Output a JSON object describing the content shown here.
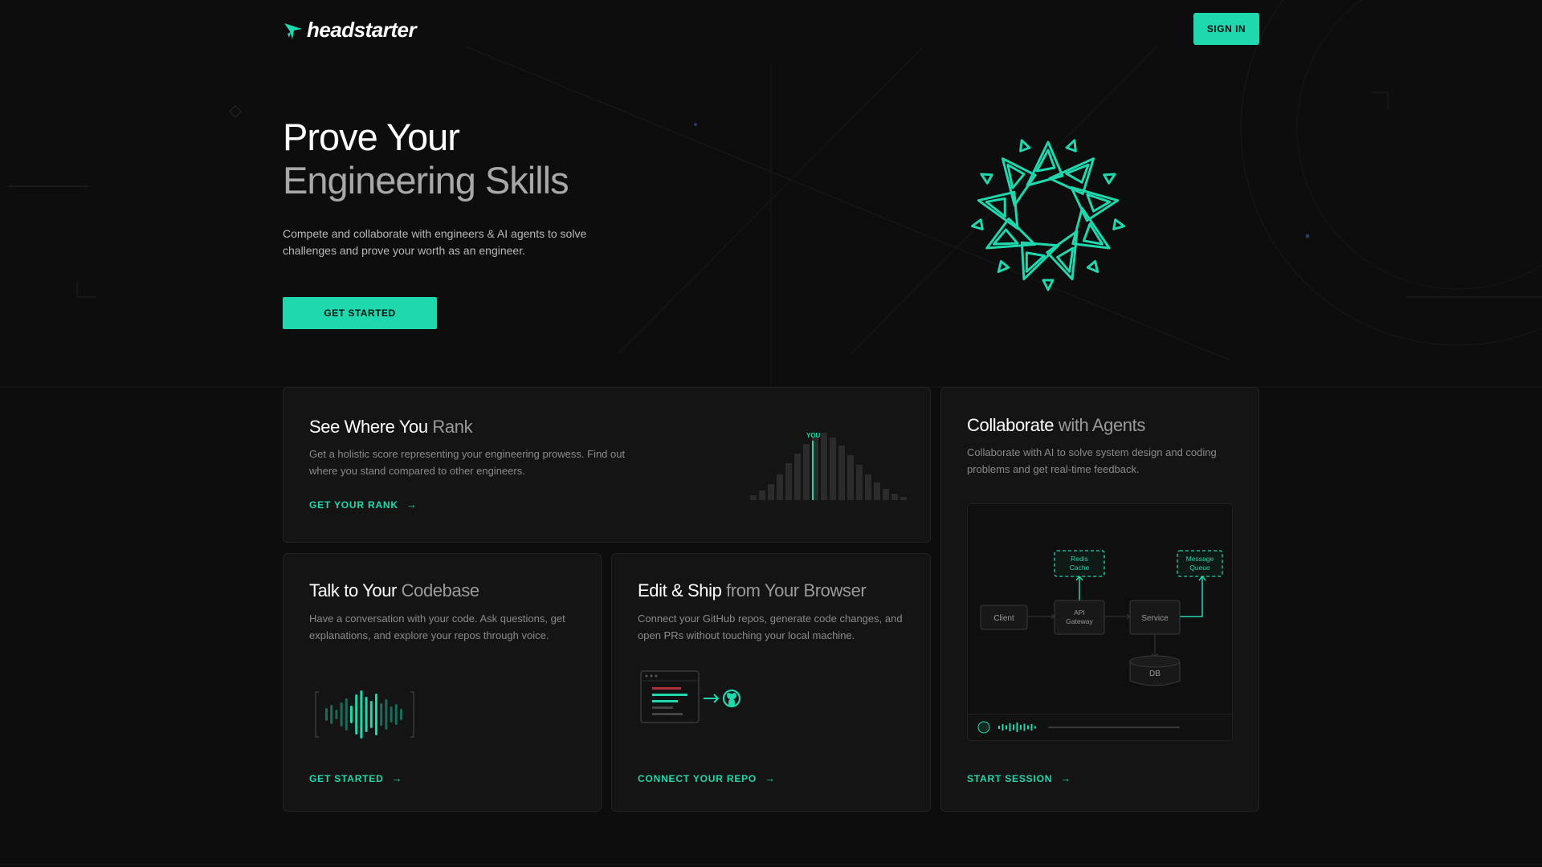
{
  "brand": {
    "name": "headstarter",
    "accent": "#1fd8ae"
  },
  "header": {
    "signin_label": "SIGN IN"
  },
  "hero": {
    "title_line1": "Prove Your",
    "title_line2": "Engineering Skills",
    "subtitle": "Compete and collaborate with engineers & AI agents to solve challenges and prove your worth as an engineer.",
    "cta_label": "GET STARTED"
  },
  "cards": {
    "rank": {
      "title_white": "See Where You",
      "title_gray": "Rank",
      "desc": "Get a holistic score representing your engineering prowess. Find out where you stand compared to other engineers.",
      "link": "GET YOUR RANK",
      "marker_label": "YOU"
    },
    "talk": {
      "title_white": "Talk to Your",
      "title_gray": "Codebase",
      "desc": "Have a conversation with your code. Ask questions, get explanations, and explore your repos through voice.",
      "link": "GET STARTED"
    },
    "ship": {
      "title_white": "Edit & Ship",
      "title_gray": "from Your Browser",
      "desc": "Connect your GitHub repos, generate code changes, and open PRs without touching your local machine.",
      "link": "CONNECT YOUR REPO"
    },
    "collab": {
      "title_white": "Collaborate",
      "title_gray": "with Agents",
      "desc": "Collaborate with AI to solve system design and coding problems and get real-time feedback.",
      "link": "START SESSION",
      "diagram": {
        "client": "Client",
        "gateway_1": "API",
        "gateway_2": "Gateway",
        "service": "Service",
        "db": "DB",
        "cache_1": "Redis",
        "cache_2": "Cache",
        "queue_1": "Message",
        "queue_2": "Queue"
      }
    }
  }
}
